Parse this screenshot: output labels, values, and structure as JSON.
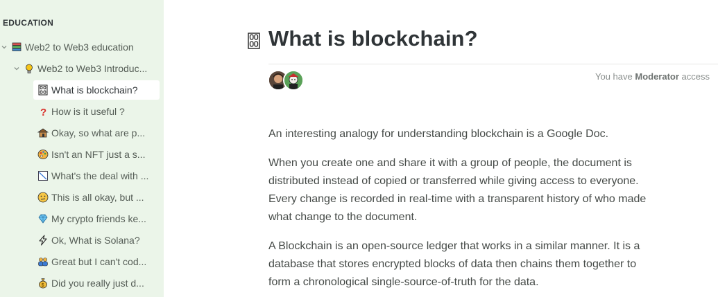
{
  "sidebar": {
    "section_label": "EDUCATION",
    "items": [
      {
        "label": "Web2 to Web3 education",
        "icon": "books-icon"
      },
      {
        "label": "Web2 to Web3 Introduc...",
        "icon": "lightbulb-icon"
      },
      {
        "label": "What is blockchain?",
        "icon": "chain-icon",
        "active": true
      },
      {
        "label": "How is it useful ?",
        "icon": "question-icon"
      },
      {
        "label": "Okay, so what are p...",
        "icon": "hut-icon"
      },
      {
        "label": "Isn't an NFT just a s...",
        "icon": "palette-icon"
      },
      {
        "label": "What's the deal with ...",
        "icon": "chart-icon"
      },
      {
        "label": "This is all okay, but ...",
        "icon": "confused-face-icon"
      },
      {
        "label": "My crypto friends ke...",
        "icon": "gem-icon"
      },
      {
        "label": "Ok, What is Solana?",
        "icon": "lightning-icon"
      },
      {
        "label": "Great but I can't cod...",
        "icon": "people-icon"
      },
      {
        "label": "Did you really just d...",
        "icon": "money-bag-icon"
      }
    ]
  },
  "page": {
    "title": "What is blockchain?",
    "icon": "chain-icon",
    "access_prefix": "You have ",
    "access_role": "Moderator",
    "access_suffix": " access",
    "paragraphs": [
      "An interesting analogy for understanding blockchain is a Google Doc.",
      "When you create one and share it with a group of people, the document is distributed instead of copied or transferred while giving access to everyone. Every change is recorded in real-time with a transparent history of who made what change to the document.",
      "A Blockchain is an open-source ledger that works in a similar manner. It is a database that stores encrypted blocks of data then chains them together to form a chronological single-source-of-truth for the data."
    ]
  },
  "colors": {
    "sidebar_bg": "#ebf5e9",
    "active_bg": "#ffffff",
    "text": "#454a47",
    "title": "#2f3437"
  }
}
